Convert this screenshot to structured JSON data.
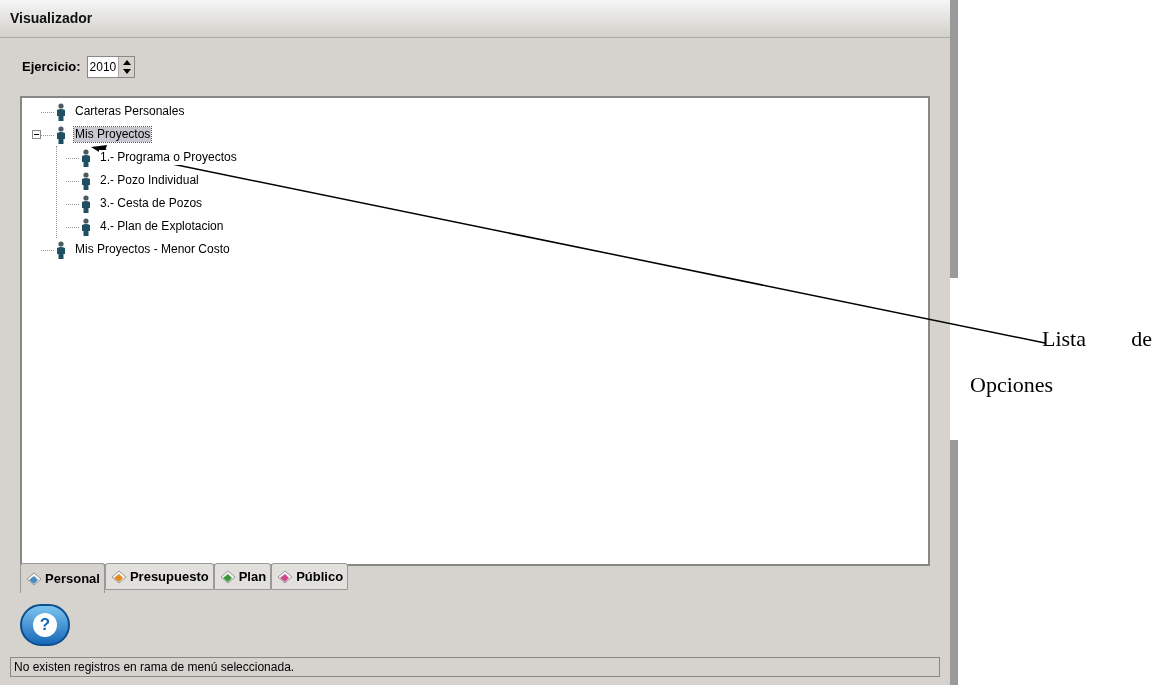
{
  "window": {
    "title": "Visualizador"
  },
  "ejercicio": {
    "label": "Ejercicio:",
    "value": "2010"
  },
  "tree": [
    {
      "label": "Carteras Personales",
      "selected": false
    },
    {
      "label": "Mis Proyectos",
      "selected": true,
      "expanded": true,
      "children": [
        {
          "label": "1.- Programa o Proyectos",
          "selected": false
        },
        {
          "label": "2.- Pozo Individual",
          "selected": false
        },
        {
          "label": "3.- Cesta de Pozos",
          "selected": false
        },
        {
          "label": "4.- Plan de Explotacion",
          "selected": false
        }
      ]
    },
    {
      "label": "Mis Proyectos - Menor Costo",
      "selected": false
    }
  ],
  "tabs": [
    {
      "label": "Personal",
      "selected": true
    },
    {
      "label": "Presupuesto",
      "selected": false
    },
    {
      "label": "Plan",
      "selected": false
    },
    {
      "label": "Público",
      "selected": false
    }
  ],
  "help_button": {
    "label": "?"
  },
  "status_bar": "No existen registros en rama de menú seleccionada.",
  "annotation": {
    "text": "Lista de Opciones"
  }
}
